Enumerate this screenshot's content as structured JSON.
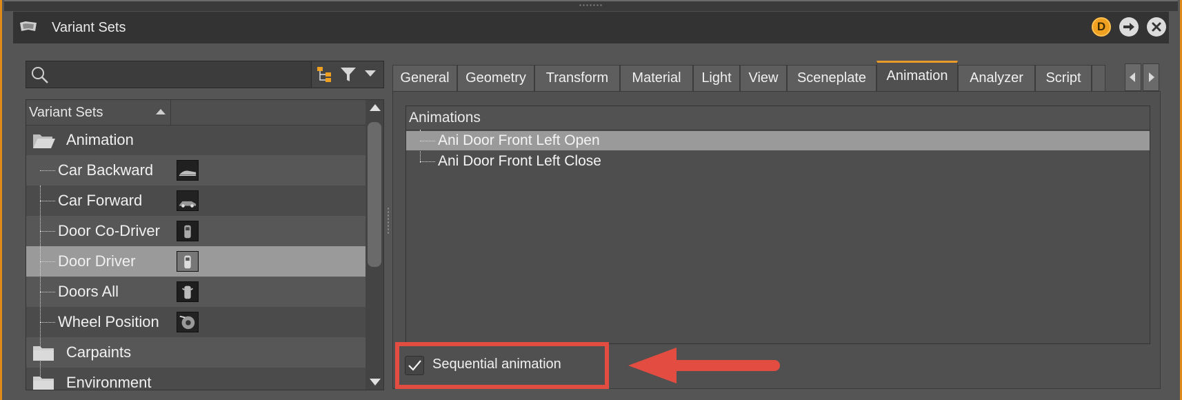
{
  "window": {
    "title": "Variant Sets",
    "buttons": {
      "dock": "D"
    }
  },
  "search": {
    "value": "",
    "placeholder": ""
  },
  "tree": {
    "column_header": "Variant Sets",
    "items": [
      {
        "label": "Animation",
        "type": "folder-open",
        "selected": false
      },
      {
        "label": "Car Backward",
        "type": "child",
        "selected": false
      },
      {
        "label": "Car Forward",
        "type": "child",
        "selected": false
      },
      {
        "label": "Door Co-Driver",
        "type": "child",
        "selected": false
      },
      {
        "label": "Door Driver",
        "type": "child",
        "selected": true
      },
      {
        "label": "Doors All",
        "type": "child",
        "selected": false
      },
      {
        "label": "Wheel Position",
        "type": "child",
        "selected": false
      },
      {
        "label": "Carpaints",
        "type": "folder",
        "selected": false
      },
      {
        "label": "Environment",
        "type": "folder",
        "selected": false
      }
    ]
  },
  "tabs": [
    {
      "label": "General"
    },
    {
      "label": "Geometry"
    },
    {
      "label": "Transform"
    },
    {
      "label": "Material"
    },
    {
      "label": "Light"
    },
    {
      "label": "View"
    },
    {
      "label": "Sceneplate"
    },
    {
      "label": "Animation",
      "active": true
    },
    {
      "label": "Analyzer"
    },
    {
      "label": "Script"
    }
  ],
  "animations": {
    "header": "Animations",
    "items": [
      {
        "label": "Ani Door Front Left Open",
        "selected": true
      },
      {
        "label": "Ani Door Front Left Close",
        "selected": false
      }
    ]
  },
  "options": {
    "sequential_label": "Sequential animation",
    "sequential_checked": true
  },
  "colors": {
    "accent_orange": "#e89a2a",
    "annotation_red": "#e34c40",
    "selection": "#9a9a9a"
  }
}
